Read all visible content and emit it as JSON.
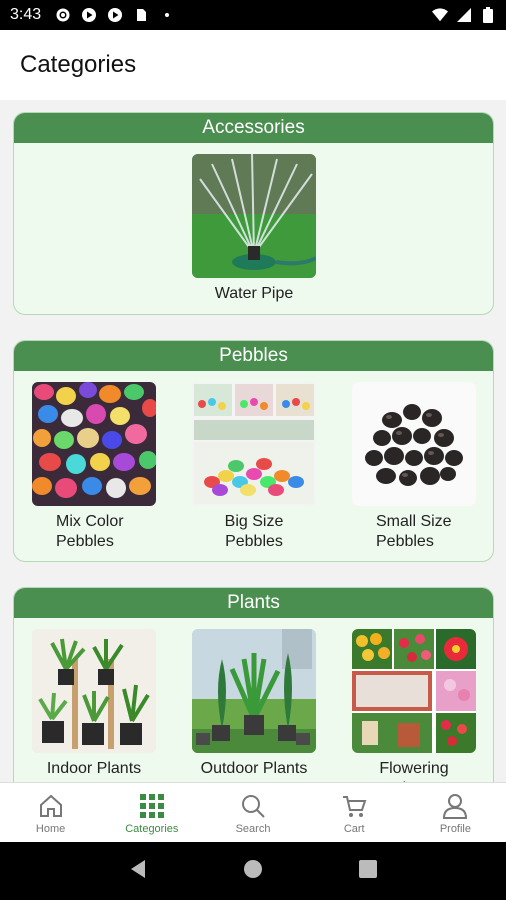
{
  "status": {
    "time": "3:43"
  },
  "app": {
    "title": "Categories"
  },
  "categories": [
    {
      "name": "Accessories",
      "items": [
        {
          "label": "Water Pipe"
        }
      ]
    },
    {
      "name": "Pebbles",
      "items": [
        {
          "label": "Mix Color Pebbles"
        },
        {
          "label": "Big Size Pebbles"
        },
        {
          "label": "Small Size Pebbles"
        }
      ]
    },
    {
      "name": "Plants",
      "items": [
        {
          "label": "Indoor Plants"
        },
        {
          "label": "Outdoor Plants"
        },
        {
          "label": "Flowering Plants"
        }
      ]
    }
  ],
  "nav": [
    {
      "label": "Home",
      "icon": "home-icon"
    },
    {
      "label": "Categories",
      "icon": "grid-icon"
    },
    {
      "label": "Search",
      "icon": "search-icon"
    },
    {
      "label": "Cart",
      "icon": "cart-icon"
    },
    {
      "label": "Profile",
      "icon": "profile-icon"
    }
  ],
  "colors": {
    "accent": "#4a8f50",
    "card_bg": "#eefaee",
    "active_nav": "#3d8a45"
  }
}
